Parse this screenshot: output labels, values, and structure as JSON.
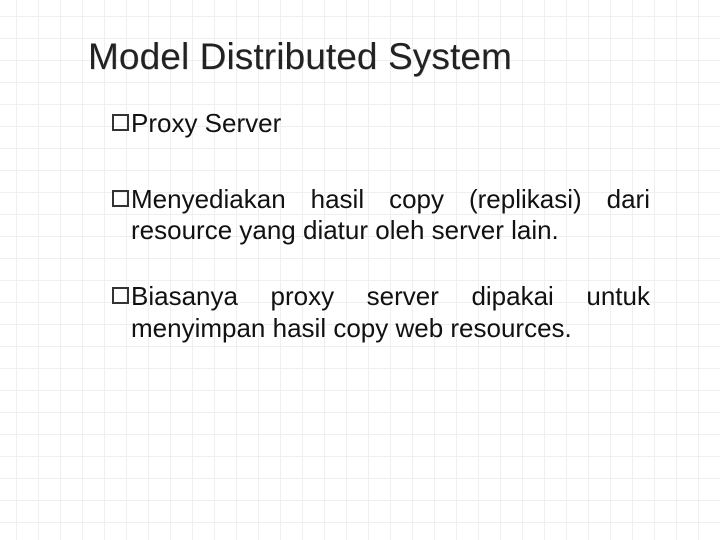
{
  "slide": {
    "title": "Model Distributed System",
    "bullets": [
      "Proxy Server",
      "Menyediakan hasil copy (replikasi) dari resource yang diatur oleh server lain.",
      "Biasanya proxy server dipakai untuk menyimpan hasil copy web resources."
    ]
  }
}
